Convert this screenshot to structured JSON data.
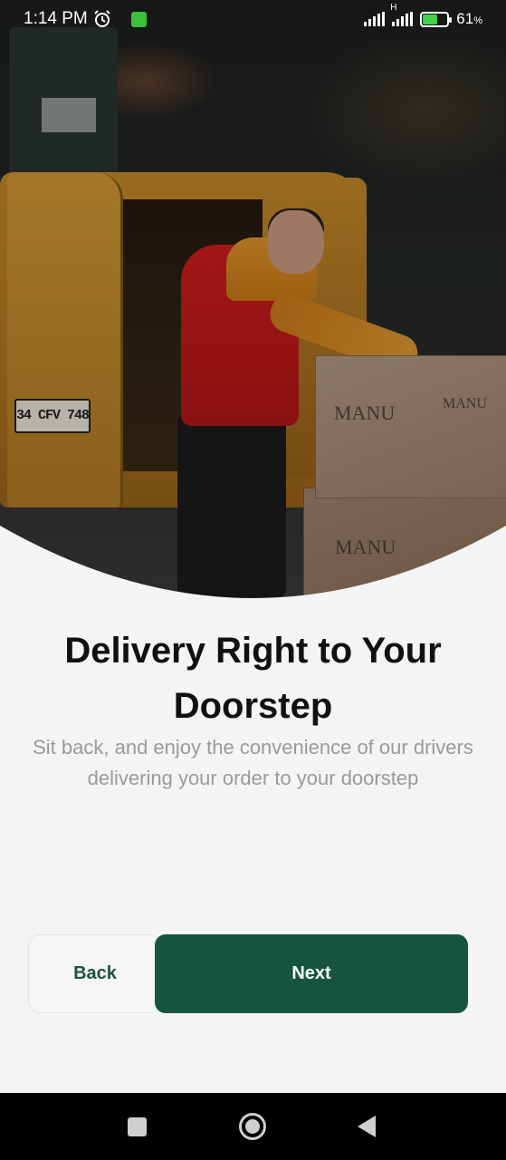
{
  "status_bar": {
    "time": "1:14 PM",
    "network_label": "H",
    "battery_percent": "61",
    "battery_unit": "%",
    "battery_level": 0.61,
    "icons": [
      "alarm-icon",
      "notification-app-icon",
      "signal-icon",
      "signal-h-icon",
      "battery-charging-icon"
    ]
  },
  "hero": {
    "image": "courier-loading-boxes-from-van",
    "plate_text": "34 CFV 748",
    "box_print": "MANU"
  },
  "onboarding": {
    "title": "Delivery Right to Your Doorstep",
    "subtitle": "Sit back, and enjoy the convenience of our drivers delivering your order to your doorstep"
  },
  "actions": {
    "back_label": "Back",
    "next_label": "Next"
  },
  "nav_bar": {
    "icons": [
      "recents-icon",
      "home-icon",
      "back-icon"
    ]
  },
  "colors": {
    "primary": "#165441",
    "background": "#f4f4f4",
    "title": "#111111",
    "subtitle": "#9a9a9a"
  }
}
